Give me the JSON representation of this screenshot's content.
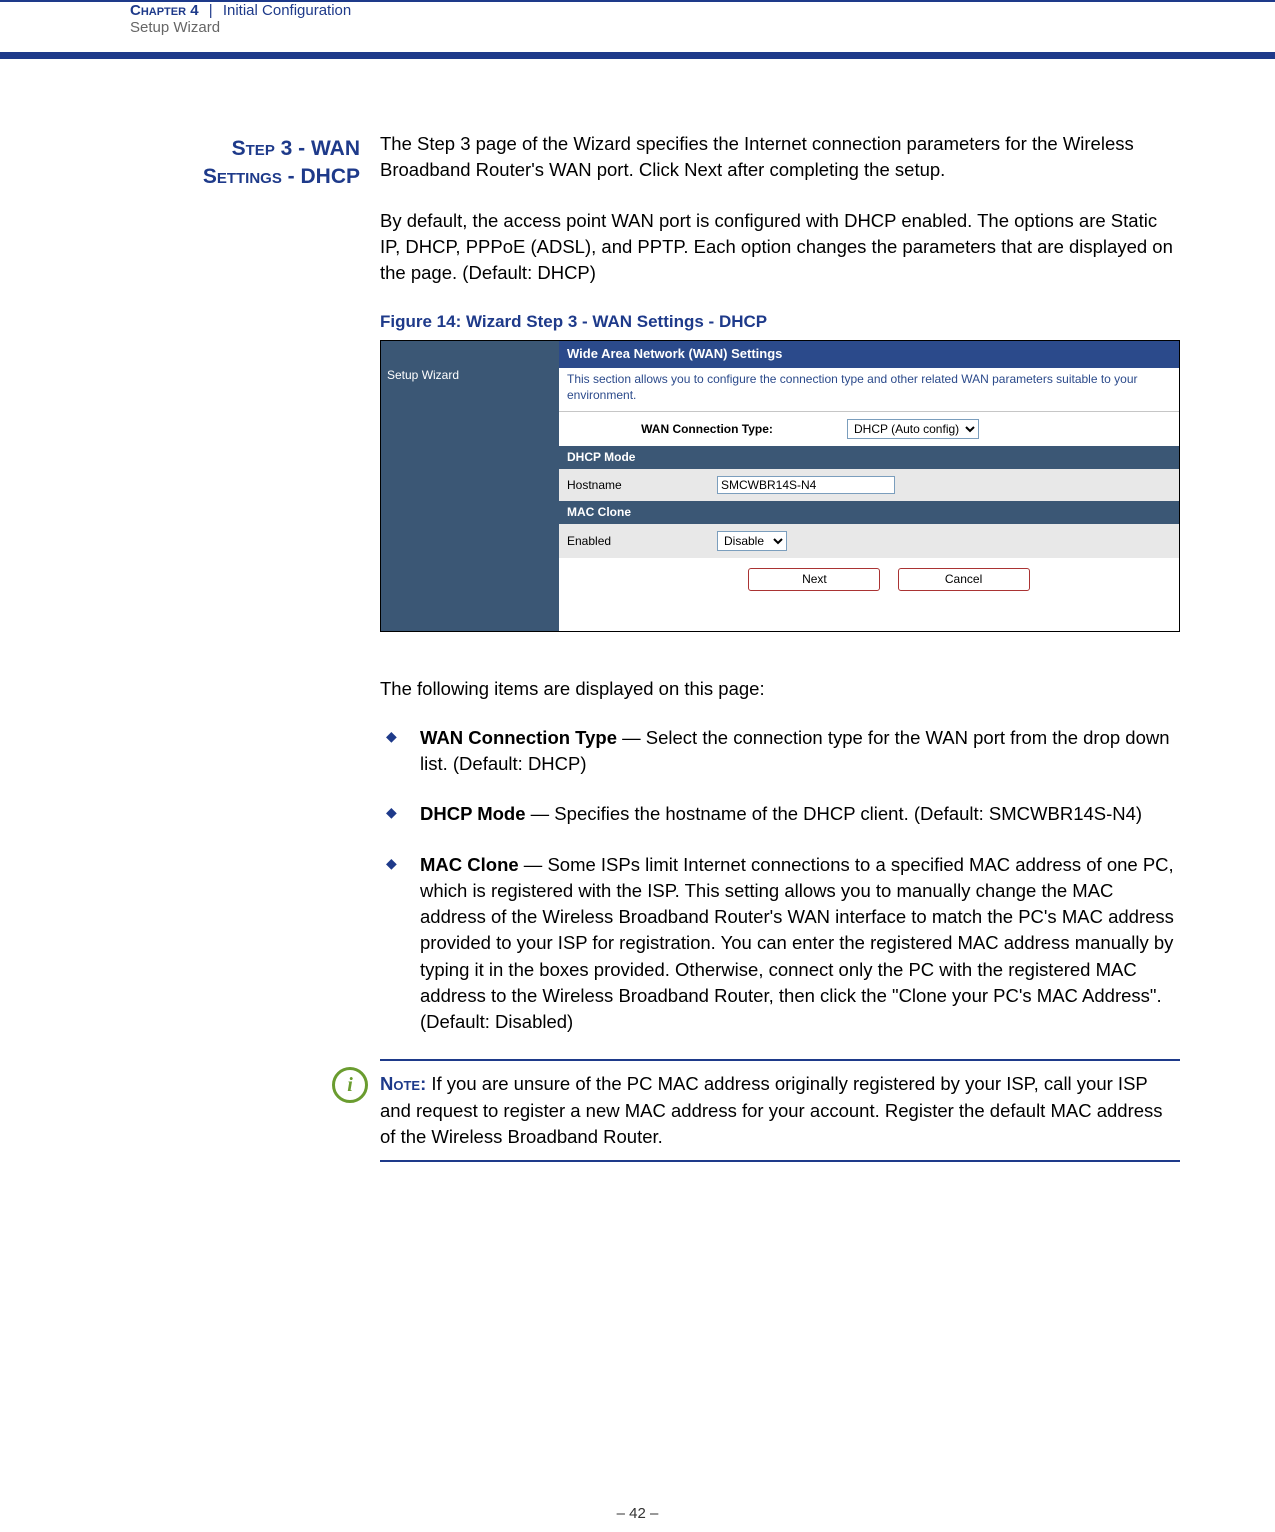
{
  "header": {
    "chapter": "Chapter 4",
    "separator": "|",
    "title": "Initial Configuration",
    "subtitle": "Setup Wizard"
  },
  "section": {
    "heading_line1": "Step 3 - WAN",
    "heading_line2": "Settings - DHCP"
  },
  "paragraphs": {
    "p1": "The Step 3 page of the Wizard specifies the Internet connection parameters for the Wireless Broadband Router's WAN port. Click Next after completing the setup.",
    "p2": "By default, the access point WAN port is configured with DHCP enabled. The options are Static IP, DHCP, PPPoE (ADSL), and PPTP. Each option changes the parameters that are displayed on the page. (Default: DHCP)",
    "figcaption": "Figure 14:  Wizard Step 3 - WAN Settings - DHCP",
    "items_intro": "The following items are displayed on this page:"
  },
  "figure": {
    "sidebar": "Setup Wizard",
    "title": "Wide Area Network (WAN) Settings",
    "desc": "This section allows you to configure the connection type and other related WAN parameters suitable to your environment.",
    "conn_label": "WAN Connection Type:",
    "conn_value": "DHCP (Auto config)",
    "dhcp_header": "DHCP Mode",
    "hostname_label": "Hostname",
    "hostname_value": "SMCWBR14S-N4",
    "mac_header": "MAC Clone",
    "enabled_label": "Enabled",
    "enabled_value": "Disable",
    "btn_next": "Next",
    "btn_cancel": "Cancel"
  },
  "bullets": {
    "b1_label": "WAN Connection Type",
    "b1_text": " — Select the connection type for the WAN port from the drop down list. (Default: DHCP)",
    "b2_label": "DHCP Mode",
    "b2_text": " — Specifies the hostname of the DHCP client. (Default: SMCWBR14S-N4)",
    "b3_label": "MAC Clone",
    "b3_text": " — Some ISPs limit Internet connections to a specified MAC address of one PC, which is registered with the ISP. This setting allows you to manually change the MAC address of the Wireless Broadband Router's WAN interface to match the PC's MAC address provided to your ISP for registration. You can enter the registered MAC address manually by typing it in the boxes provided. Otherwise, connect only the PC with the registered MAC address to the Wireless Broadband Router, then click the \"Clone your PC's MAC Address\". (Default: Disabled)"
  },
  "note": {
    "icon": "i",
    "label": "Note:",
    "text": " If you are unsure of the PC MAC address originally registered by your ISP, call your ISP and request to register a new MAC address for your account. Register the default MAC address of the Wireless Broadband Router."
  },
  "footer": "–  42  –"
}
